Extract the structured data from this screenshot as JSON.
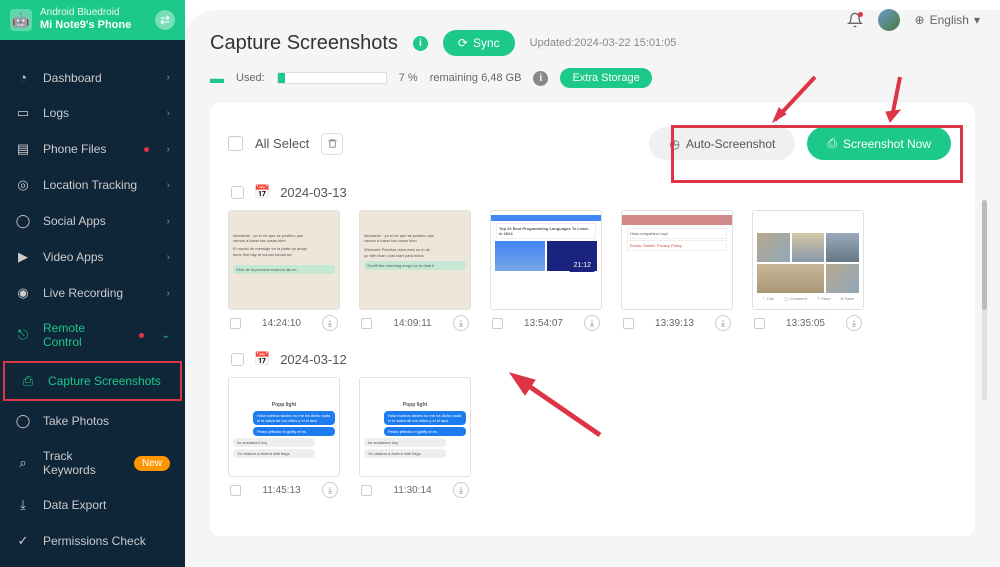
{
  "device": {
    "platform": "Android Bluedroid",
    "model": "Mi Note9's Phone"
  },
  "lang": "English",
  "nav": [
    {
      "label": "Dashboard",
      "icon": "◔"
    },
    {
      "label": "Logs",
      "icon": "▭"
    },
    {
      "label": "Phone Files",
      "icon": "▤",
      "dot": true
    },
    {
      "label": "Location Tracking",
      "icon": "◎"
    },
    {
      "label": "Social Apps",
      "icon": "◯"
    },
    {
      "label": "Video Apps",
      "icon": "▶"
    },
    {
      "label": "Live Recording",
      "icon": "◉"
    },
    {
      "label": "Remote Control",
      "icon": "⎋",
      "rc": true,
      "dot": true
    },
    {
      "label": "Capture Screenshots",
      "icon": "⎙",
      "active": true
    },
    {
      "label": "Take Photos",
      "icon": "◯"
    },
    {
      "label": "Track Keywords",
      "icon": "⌕",
      "badge": "New"
    },
    {
      "label": "Data Export",
      "icon": "⤓"
    },
    {
      "label": "Permissions Check",
      "icon": "✓"
    }
  ],
  "page": {
    "title": "Capture Screenshots",
    "sync": "Sync",
    "updated": "Updated:2024-03-22 15:01:05",
    "used_label": "Used:",
    "used_pct": "7 %",
    "remaining": "remaining 6,48 GB",
    "extra": "Extra Storage"
  },
  "card": {
    "all_select": "All Select",
    "auto": "Auto-Screenshot",
    "now": "Screenshot Now"
  },
  "dates": [
    {
      "date": "2024-03-13",
      "items": [
        {
          "time": "14:24:10",
          "kind": "whatsapp"
        },
        {
          "time": "14:09:11",
          "kind": "whatsapp2"
        },
        {
          "time": "13:54:07",
          "kind": "browser"
        },
        {
          "time": "13:39:13",
          "kind": "list"
        },
        {
          "time": "13:35:05",
          "kind": "photos"
        }
      ]
    },
    {
      "date": "2024-03-12",
      "items": [
        {
          "time": "11:45:13",
          "kind": "chat"
        },
        {
          "time": "11:30:14",
          "kind": "chat"
        }
      ]
    }
  ]
}
